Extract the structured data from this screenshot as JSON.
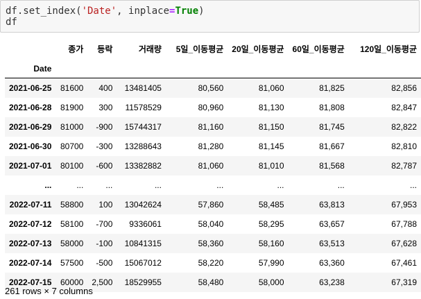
{
  "code": {
    "line1": {
      "p1": "df.set_index(",
      "p2": "'Date'",
      "p3": ", inplace",
      "p4": "=",
      "p5": "True",
      "p6": ")"
    },
    "line2": "df"
  },
  "table": {
    "columns": [
      "종가",
      "등락",
      "거래량",
      "5일_이동평균",
      "20일_이동평균",
      "60일_이동평균",
      "120일_이동평균"
    ],
    "index_name": "Date",
    "rows": [
      {
        "index": "2021-06-25",
        "cells": [
          "81600",
          "400",
          "13481405",
          "80,560",
          "81,060",
          "81,825",
          "82,856"
        ]
      },
      {
        "index": "2021-06-28",
        "cells": [
          "81900",
          "300",
          "11578529",
          "80,960",
          "81,130",
          "81,808",
          "82,847"
        ]
      },
      {
        "index": "2021-06-29",
        "cells": [
          "81000",
          "-900",
          "15744317",
          "81,160",
          "81,150",
          "81,745",
          "82,822"
        ]
      },
      {
        "index": "2021-06-30",
        "cells": [
          "80700",
          "-300",
          "13288643",
          "81,280",
          "81,145",
          "81,667",
          "82,810"
        ]
      },
      {
        "index": "2021-07-01",
        "cells": [
          "80100",
          "-600",
          "13382882",
          "81,060",
          "81,010",
          "81,568",
          "82,787"
        ]
      },
      {
        "index": "...",
        "cells": [
          "...",
          "...",
          "...",
          "...",
          "...",
          "...",
          "..."
        ]
      },
      {
        "index": "2022-07-11",
        "cells": [
          "58800",
          "100",
          "13042624",
          "57,860",
          "58,485",
          "63,813",
          "67,953"
        ]
      },
      {
        "index": "2022-07-12",
        "cells": [
          "58100",
          "-700",
          "9336061",
          "58,040",
          "58,295",
          "63,657",
          "67,788"
        ]
      },
      {
        "index": "2022-07-13",
        "cells": [
          "58000",
          "-100",
          "10841315",
          "58,360",
          "58,160",
          "63,513",
          "67,628"
        ]
      },
      {
        "index": "2022-07-14",
        "cells": [
          "57500",
          "-500",
          "15067012",
          "58,220",
          "57,990",
          "63,360",
          "67,461"
        ]
      },
      {
        "index": "2022-07-15",
        "cells": [
          "60000",
          "2,500",
          "18529955",
          "58,480",
          "58,000",
          "63,238",
          "67,319"
        ]
      }
    ]
  },
  "summary": "261 rows × 7 columns"
}
